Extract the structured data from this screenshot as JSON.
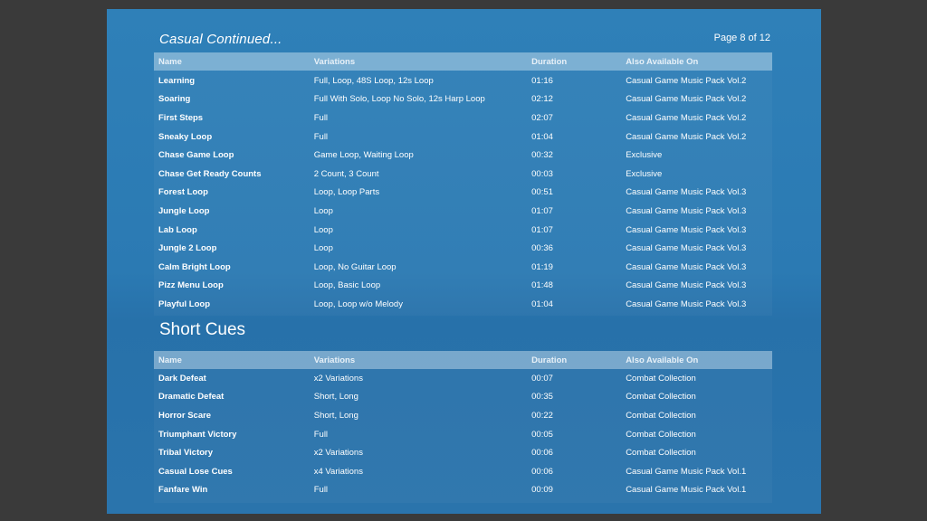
{
  "header": {
    "section_title": "Casual Continued...",
    "page_indicator": "Page 8 of 12"
  },
  "columns": [
    "Name",
    "Variations",
    "Duration",
    "Also Available On"
  ],
  "casual_rows": [
    {
      "name": "Learning",
      "variations": "Full, Loop, 48S Loop, 12s Loop",
      "duration": "01:16",
      "available": "Casual Game Music Pack Vol.2"
    },
    {
      "name": "Soaring",
      "variations": "Full With Solo, Loop No Solo, 12s Harp Loop",
      "duration": "02:12",
      "available": "Casual Game Music Pack Vol.2"
    },
    {
      "name": "First Steps",
      "variations": "Full",
      "duration": "02:07",
      "available": "Casual Game Music Pack Vol.2"
    },
    {
      "name": "Sneaky Loop",
      "variations": "Full",
      "duration": "01:04",
      "available": "Casual Game Music Pack Vol.2"
    },
    {
      "name": "Chase Game Loop",
      "variations": "Game Loop, Waiting Loop",
      "duration": "00:32",
      "available": "Exclusive"
    },
    {
      "name": "Chase Get Ready Counts",
      "variations": "2 Count, 3 Count",
      "duration": "00:03",
      "available": "Exclusive"
    },
    {
      "name": "Forest Loop",
      "variations": "Loop, Loop Parts",
      "duration": "00:51",
      "available": "Casual Game Music Pack Vol.3"
    },
    {
      "name": "Jungle Loop",
      "variations": "Loop",
      "duration": "01:07",
      "available": "Casual Game Music Pack Vol.3"
    },
    {
      "name": "Lab Loop",
      "variations": "Loop",
      "duration": "01:07",
      "available": "Casual Game Music Pack Vol.3"
    },
    {
      "name": "Jungle 2 Loop",
      "variations": "Loop",
      "duration": "00:36",
      "available": "Casual Game Music Pack Vol.3"
    },
    {
      "name": "Calm Bright Loop",
      "variations": "Loop, No Guitar Loop",
      "duration": "01:19",
      "available": "Casual Game Music Pack Vol.3"
    },
    {
      "name": "Pizz Menu Loop",
      "variations": "Loop, Basic Loop",
      "duration": "01:48",
      "available": "Casual Game Music Pack Vol.3"
    },
    {
      "name": "Playful Loop",
      "variations": "Loop, Loop w/o Melody",
      "duration": "01:04",
      "available": "Casual Game Music Pack Vol.3"
    }
  ],
  "short_cues": {
    "title": "Short Cues",
    "rows": [
      {
        "name": "Dark Defeat",
        "variations": "x2 Variations",
        "duration": "00:07",
        "available": "Combat Collection"
      },
      {
        "name": "Dramatic Defeat",
        "variations": "Short, Long",
        "duration": "00:35",
        "available": "Combat Collection"
      },
      {
        "name": "Horror Scare",
        "variations": "Short, Long",
        "duration": "00:22",
        "available": "Combat Collection"
      },
      {
        "name": "Triumphant Victory",
        "variations": "Full",
        "duration": "00:05",
        "available": "Combat Collection"
      },
      {
        "name": "Tribal Victory",
        "variations": "x2 Variations",
        "duration": "00:06",
        "available": "Combat Collection"
      },
      {
        "name": "Casual Lose Cues",
        "variations": "x4 Variations",
        "duration": "00:06",
        "available": "Casual Game Music Pack Vol.1"
      },
      {
        "name": "Fanfare Win",
        "variations": "Full",
        "duration": "00:09",
        "available": "Casual Game Music Pack Vol.1"
      }
    ]
  }
}
